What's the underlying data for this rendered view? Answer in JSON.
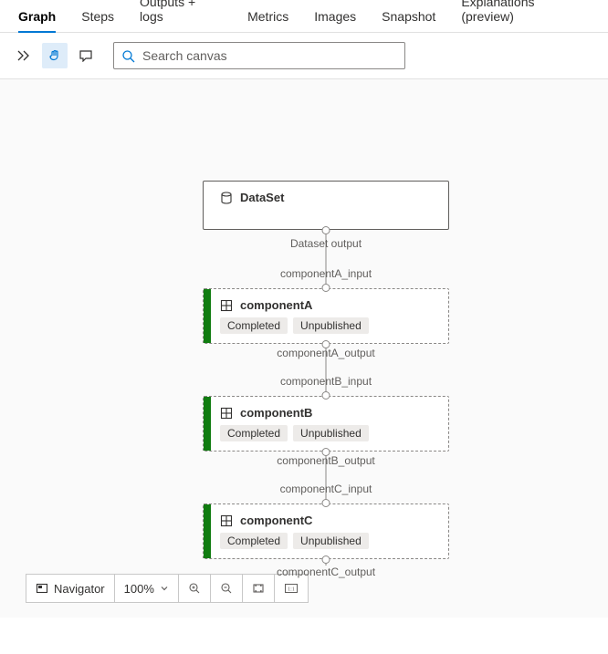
{
  "tabs": [
    {
      "label": "Graph",
      "active": true
    },
    {
      "label": "Steps"
    },
    {
      "label": "Outputs + logs"
    },
    {
      "label": "Metrics"
    },
    {
      "label": "Images"
    },
    {
      "label": "Snapshot"
    },
    {
      "label": "Explanations (preview)"
    }
  ],
  "toolbar": {
    "search_placeholder": "Search canvas"
  },
  "graph": {
    "nodes": {
      "dataset": {
        "title": "DataSet"
      },
      "componentA": {
        "title": "componentA",
        "status": "Completed",
        "publish": "Unpublished"
      },
      "componentB": {
        "title": "componentB",
        "status": "Completed",
        "publish": "Unpublished"
      },
      "componentC": {
        "title": "componentC",
        "status": "Completed",
        "publish": "Unpublished"
      }
    },
    "edges": {
      "ds_out": "Dataset output",
      "a_in": "componentA_input",
      "a_out": "componentA_output",
      "b_in": "componentB_input",
      "b_out": "componentB_output",
      "c_in": "componentC_input",
      "c_out": "componentC_output"
    }
  },
  "footer": {
    "navigator": "Navigator",
    "zoom": "100%"
  }
}
